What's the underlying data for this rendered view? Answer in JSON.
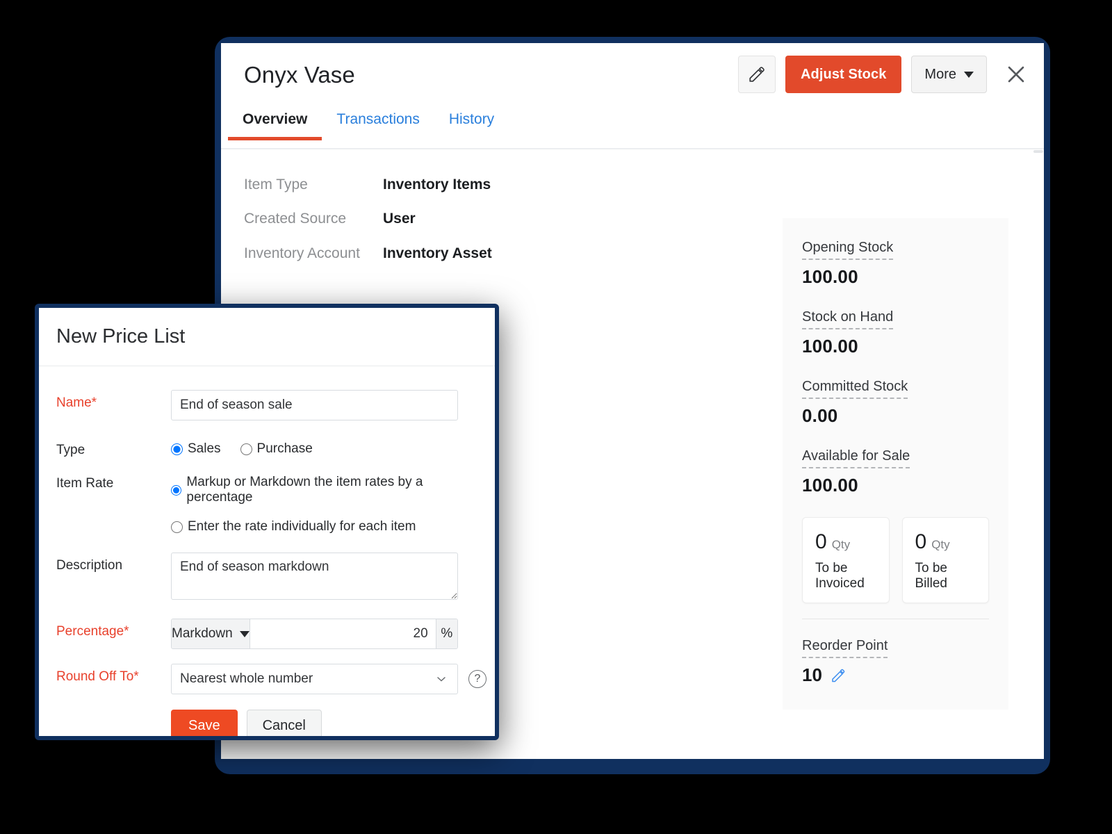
{
  "item_window": {
    "title": "Onyx Vase",
    "actions": {
      "edit_icon": "pencil-icon",
      "primary_label": "Adjust Stock",
      "more_label": "More",
      "close_icon": "close-icon"
    },
    "tabs": [
      {
        "label": "Overview",
        "active": true
      },
      {
        "label": "Transactions",
        "active": false
      },
      {
        "label": "History",
        "active": false
      }
    ],
    "details": [
      {
        "label": "Item Type",
        "value": "Inventory Items"
      },
      {
        "label": "Created Source",
        "value": "User"
      },
      {
        "label": "Inventory Account",
        "value": "Inventory Asset"
      }
    ],
    "stock_panel": {
      "blocks": [
        {
          "label": "Opening Stock",
          "value": "100.00"
        },
        {
          "label": "Stock on Hand",
          "value": "100.00"
        },
        {
          "label": "Committed Stock",
          "value": "0.00"
        },
        {
          "label": "Available for Sale",
          "value": "100.00"
        }
      ],
      "qty_cards": [
        {
          "number": "0",
          "unit": "Qty",
          "caption": "To be Invoiced"
        },
        {
          "number": "0",
          "unit": "Qty",
          "caption": "To be Billed"
        }
      ],
      "reorder": {
        "label": "Reorder Point",
        "value": "10",
        "edit_icon": "pencil-icon"
      }
    }
  },
  "modal": {
    "title": "New Price List",
    "fields": {
      "name": {
        "label": "Name*",
        "value": "End of season sale",
        "placeholder": ""
      },
      "type": {
        "label": "Type",
        "options": [
          {
            "label": "Sales",
            "selected": true
          },
          {
            "label": "Purchase",
            "selected": false
          }
        ]
      },
      "item_rate": {
        "label": "Item Rate",
        "options": [
          {
            "label": "Markup or Markdown the item rates by a percentage",
            "selected": true
          },
          {
            "label": "Enter the rate individually for each item",
            "selected": false
          }
        ]
      },
      "description": {
        "label": "Description",
        "value": "End of season markdown",
        "placeholder": ""
      },
      "percentage": {
        "label": "Percentage*",
        "mode": "Markdown",
        "value": "20",
        "suffix": "%"
      },
      "round_off": {
        "label": "Round Off To*",
        "value": "Nearest whole number",
        "help_icon": "help-icon"
      }
    },
    "buttons": {
      "save": "Save",
      "cancel": "Cancel"
    }
  },
  "colors": {
    "accent_red": "#e24a2b",
    "save_red": "#ee4a23",
    "link_blue": "#2a7fdc",
    "frame_navy": "#10305f",
    "required_red": "#e8412c"
  }
}
